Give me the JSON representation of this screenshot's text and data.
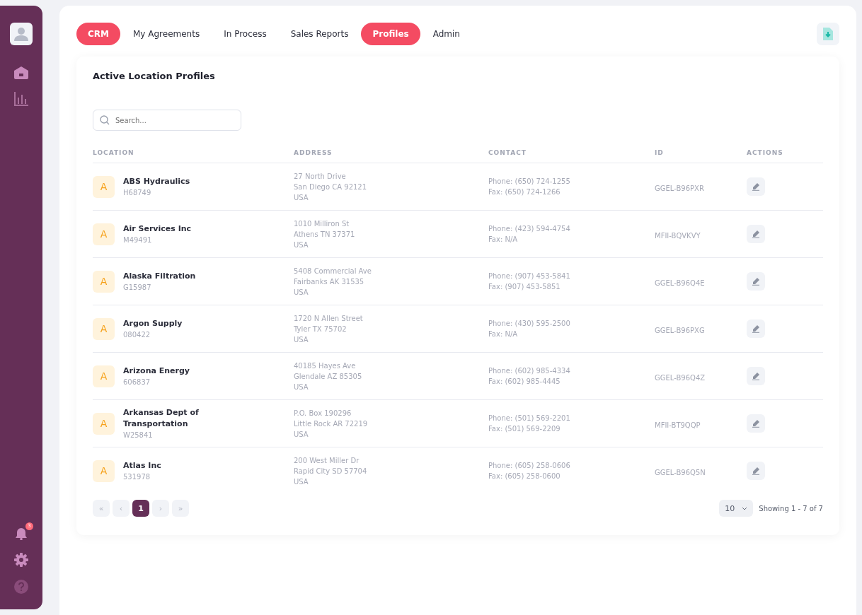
{
  "sidebar": {
    "notification_count": "3"
  },
  "tabs": [
    {
      "label": "CRM",
      "selected": true
    },
    {
      "label": "My Agreements",
      "selected": false
    },
    {
      "label": "In Process",
      "selected": false
    },
    {
      "label": "Sales Reports",
      "selected": false
    },
    {
      "label": "Profiles",
      "selected": true
    },
    {
      "label": "Admin",
      "selected": false
    }
  ],
  "card": {
    "title": "Active Location Profiles",
    "search": {
      "placeholder": "Search..."
    }
  },
  "table": {
    "columns": [
      "LOCATION",
      "ADDRESS",
      "CONTACT",
      "ID",
      "ACTIONS"
    ],
    "rows": [
      {
        "initial": "A",
        "name": "ABS Hydraulics",
        "code": "H68749",
        "address": [
          "27 North Drive",
          "San Diego CA 92121",
          "USA"
        ],
        "contact": [
          "Phone: (650) 724-1255",
          "Fax: (650) 724-1266"
        ],
        "id": "GGEL-B96PXR"
      },
      {
        "initial": "A",
        "name": "Air Services Inc",
        "code": "M49491",
        "address": [
          "1010 Milliron St",
          "Athens TN 37371",
          "USA"
        ],
        "contact": [
          "Phone: (423) 594-4754",
          "Fax: N/A"
        ],
        "id": "MFII-BQVKVY"
      },
      {
        "initial": "A",
        "name": "Alaska Filtration",
        "code": "G15987",
        "address": [
          "5408 Commercial Ave",
          "Fairbanks AK 31535",
          "USA"
        ],
        "contact": [
          "Phone: (907) 453-5841",
          "Fax: (907) 453-5851"
        ],
        "id": "GGEL-B96Q4E"
      },
      {
        "initial": "A",
        "name": "Argon Supply",
        "code": "080422",
        "address": [
          "1720 N Allen Street",
          "Tyler TX 75702",
          "USA"
        ],
        "contact": [
          "Phone: (430) 595-2500",
          "Fax: N/A"
        ],
        "id": "GGEL-B96PXG"
      },
      {
        "initial": "A",
        "name": "Arizona Energy",
        "code": "606837",
        "address": [
          "40185 Hayes Ave",
          "Glendale AZ 85305",
          "USA"
        ],
        "contact": [
          "Phone: (602) 985-4334",
          "Fax: (602) 985-4445"
        ],
        "id": "GGEL-B96Q4Z"
      },
      {
        "initial": "A",
        "name": "Arkansas Dept of Transportation",
        "code": "W25841",
        "address": [
          "P.O. Box 190296",
          "Little Rock AR 72219",
          "USA"
        ],
        "contact": [
          "Phone: (501) 569-2201",
          "Fax: (501) 569-2209"
        ],
        "id": "MFII-BT9QQP"
      },
      {
        "initial": "A",
        "name": "Atlas Inc",
        "code": "531978",
        "address": [
          "200 West Miller Dr",
          "Rapid City SD 57704",
          "USA"
        ],
        "contact": [
          "Phone: (605) 258-0606",
          "Fax: (605) 258-0600"
        ],
        "id": "GGEL-B96Q5N"
      }
    ]
  },
  "pagination": {
    "first": "«",
    "prev": "‹",
    "pages": [
      {
        "label": "1",
        "selected": true
      }
    ],
    "next": "›",
    "last": "»",
    "page_size": "10",
    "summary": "Showing 1 - 7 of 7"
  }
}
